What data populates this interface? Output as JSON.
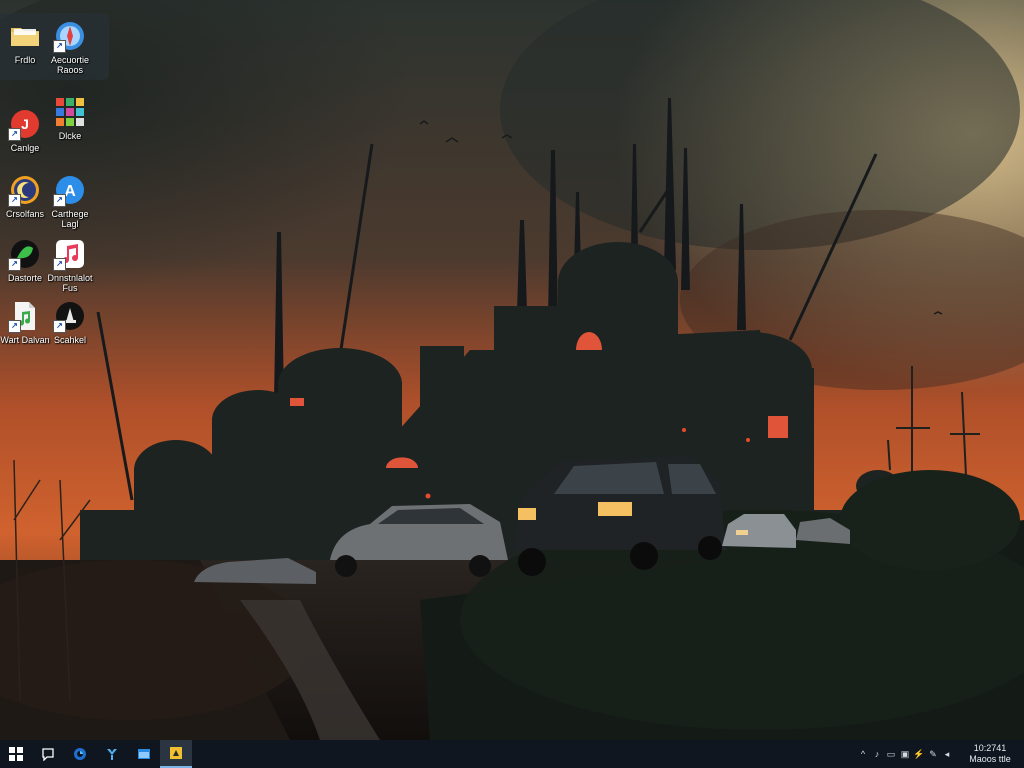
{
  "desktop": {
    "icons": [
      {
        "label": "Frdlo",
        "icon": "folder-icon"
      },
      {
        "label": "Aecuortie\nRaoos",
        "icon": "compass-app-icon"
      },
      {
        "label": "Canlge",
        "icon": "red-circle-app-icon"
      },
      {
        "label": "Dlcke",
        "icon": "tiles-grid-icon"
      },
      {
        "label": "Crsolfans",
        "icon": "moon-badge-icon"
      },
      {
        "label": "Carthege\nLagl",
        "icon": "blue-a-app-icon"
      },
      {
        "label": "Dastorte",
        "icon": "green-leaf-icon"
      },
      {
        "label": "Dnnstnlalot\nFus",
        "icon": "music-note-icon"
      },
      {
        "label": "Wart Dalvan",
        "icon": "document-music-icon"
      },
      {
        "label": "Scahkel",
        "icon": "dark-circle-app-icon"
      }
    ]
  },
  "taskbar": {
    "buttons": [
      {
        "icon": "windows-start-icon"
      },
      {
        "icon": "chat-bubble-icon"
      },
      {
        "icon": "edge-browser-icon"
      },
      {
        "icon": "bird-app-icon"
      },
      {
        "icon": "window-app-icon"
      },
      {
        "icon": "yellow-app-icon"
      }
    ],
    "tray": [
      "^",
      "♪",
      "▭",
      "▣",
      "⚡",
      "✎",
      "◂"
    ],
    "clock": {
      "time": "10:2741",
      "date": "Maoos ttle"
    }
  }
}
